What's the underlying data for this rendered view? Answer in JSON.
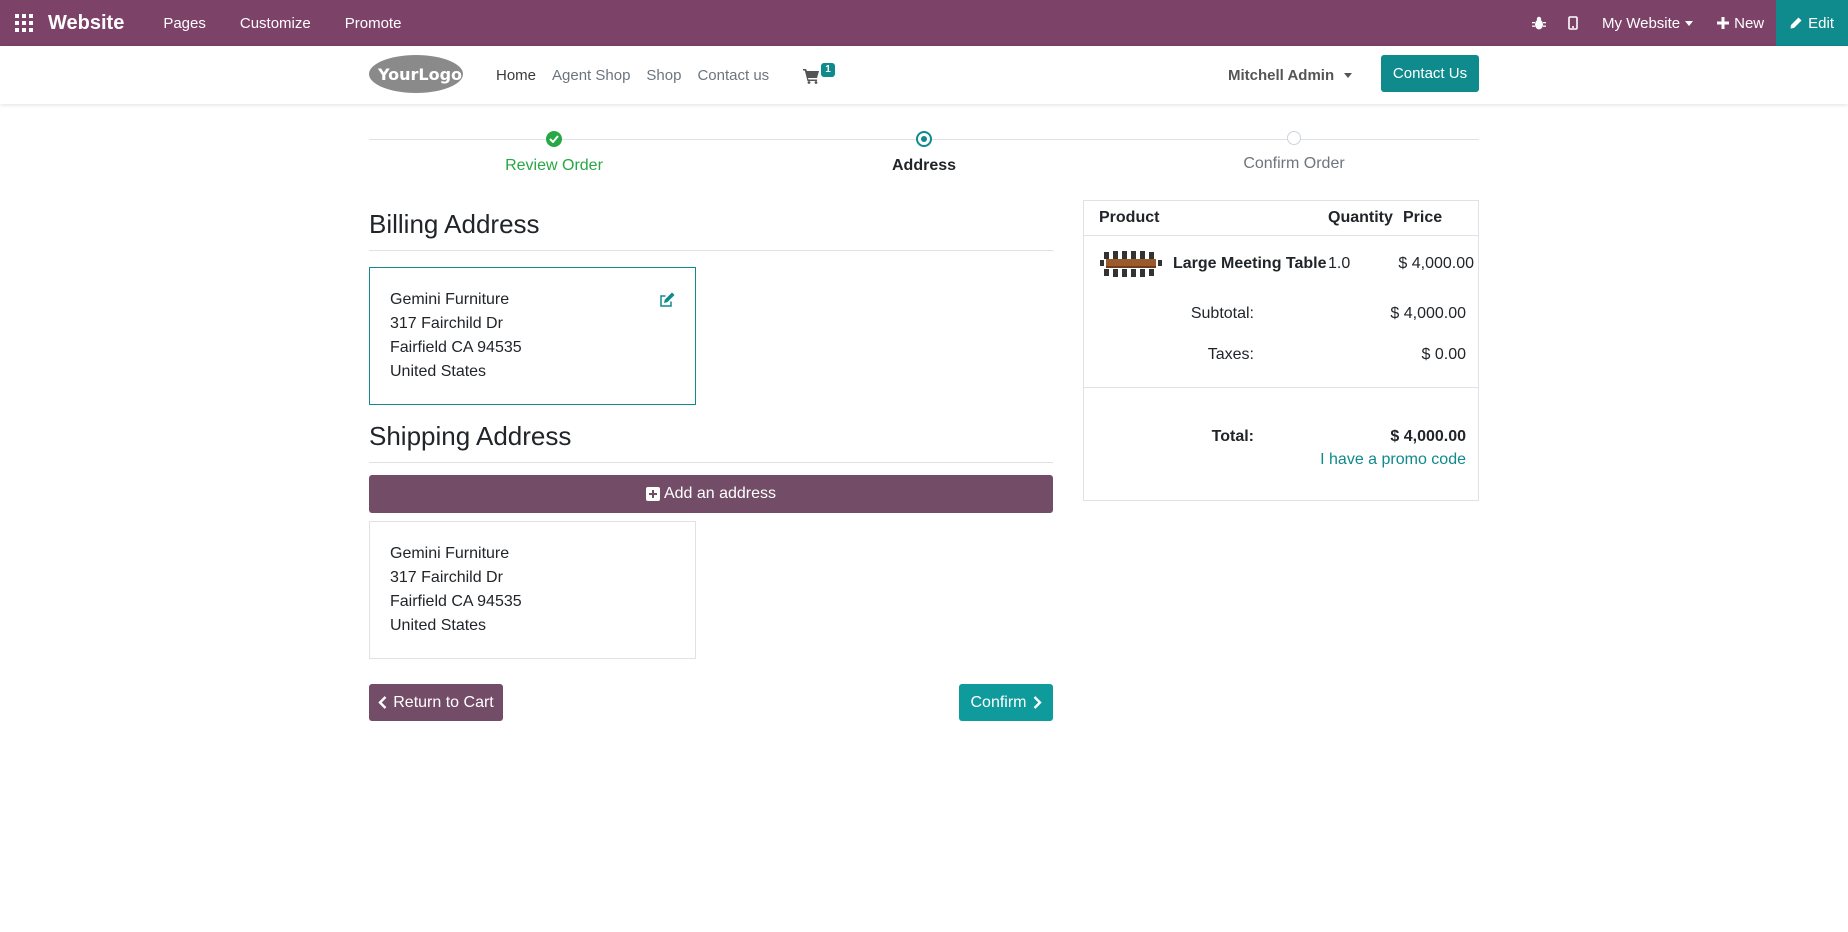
{
  "admin_bar": {
    "brand": "Website",
    "menu": [
      "Pages",
      "Customize",
      "Promote"
    ],
    "website_selector": "My Website",
    "new_label": "New",
    "edit_label": "Edit"
  },
  "header": {
    "logo_text": "YourLogo",
    "nav": [
      "Home",
      "Agent Shop",
      "Shop",
      "Contact us"
    ],
    "cart_count": "1",
    "user_name": "Mitchell Admin",
    "cta_label": "Contact Us"
  },
  "wizard": {
    "steps": [
      {
        "label": "Review Order",
        "state": "done"
      },
      {
        "label": "Address",
        "state": "current"
      },
      {
        "label": "Confirm Order",
        "state": "todo"
      }
    ]
  },
  "billing": {
    "title": "Billing Address",
    "address": [
      "Gemini Furniture",
      "317 Fairchild Dr",
      "Fairfield CA 94535",
      "United States"
    ]
  },
  "shipping": {
    "title": "Shipping Address",
    "add_label": "Add an address",
    "address": [
      "Gemini Furniture",
      "317 Fairchild Dr",
      "Fairfield CA 94535",
      "United States"
    ]
  },
  "actions": {
    "return_label": "Return to Cart",
    "confirm_label": "Confirm"
  },
  "summary": {
    "headers": {
      "product": "Product",
      "quantity": "Quantity",
      "price": "Price"
    },
    "item": {
      "name": "Large Meeting Table",
      "quantity": "1.0",
      "price": "$ 4,000.00"
    },
    "subtotal_label": "Subtotal:",
    "subtotal": "$ 4,000.00",
    "taxes_label": "Taxes:",
    "taxes": "$ 0.00",
    "total_label": "Total:",
    "total": "$ 4,000.00",
    "promo_label": "I have a promo code"
  },
  "colors": {
    "admin_bar": "#7c4268",
    "primary": "#0f8a8d",
    "secondary": "#734d67",
    "success": "#28a745"
  }
}
